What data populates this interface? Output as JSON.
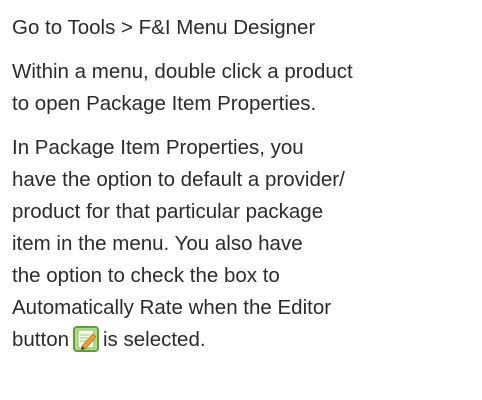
{
  "instructions": {
    "step1": "Go to Tools > F&I Menu Designer",
    "step2": "Within a menu, double click a product\nto open Package Item Properties.",
    "step3": "In Package Item Properties, you\nhave the option to default a provider/\nproduct for that particular package\nitem in the menu. You also have\nthe option to check the box to\nAutomatically Rate when the Editor\nbutton",
    "step3_tail": "is selected.",
    "editor_icon": "pencil-edit-icon",
    "icon_colors": {
      "frame": "#5d9e3a",
      "fill": "#b9dd8e",
      "pencil": "#e8a23a",
      "pencil_tip": "#3a3a3a"
    }
  }
}
